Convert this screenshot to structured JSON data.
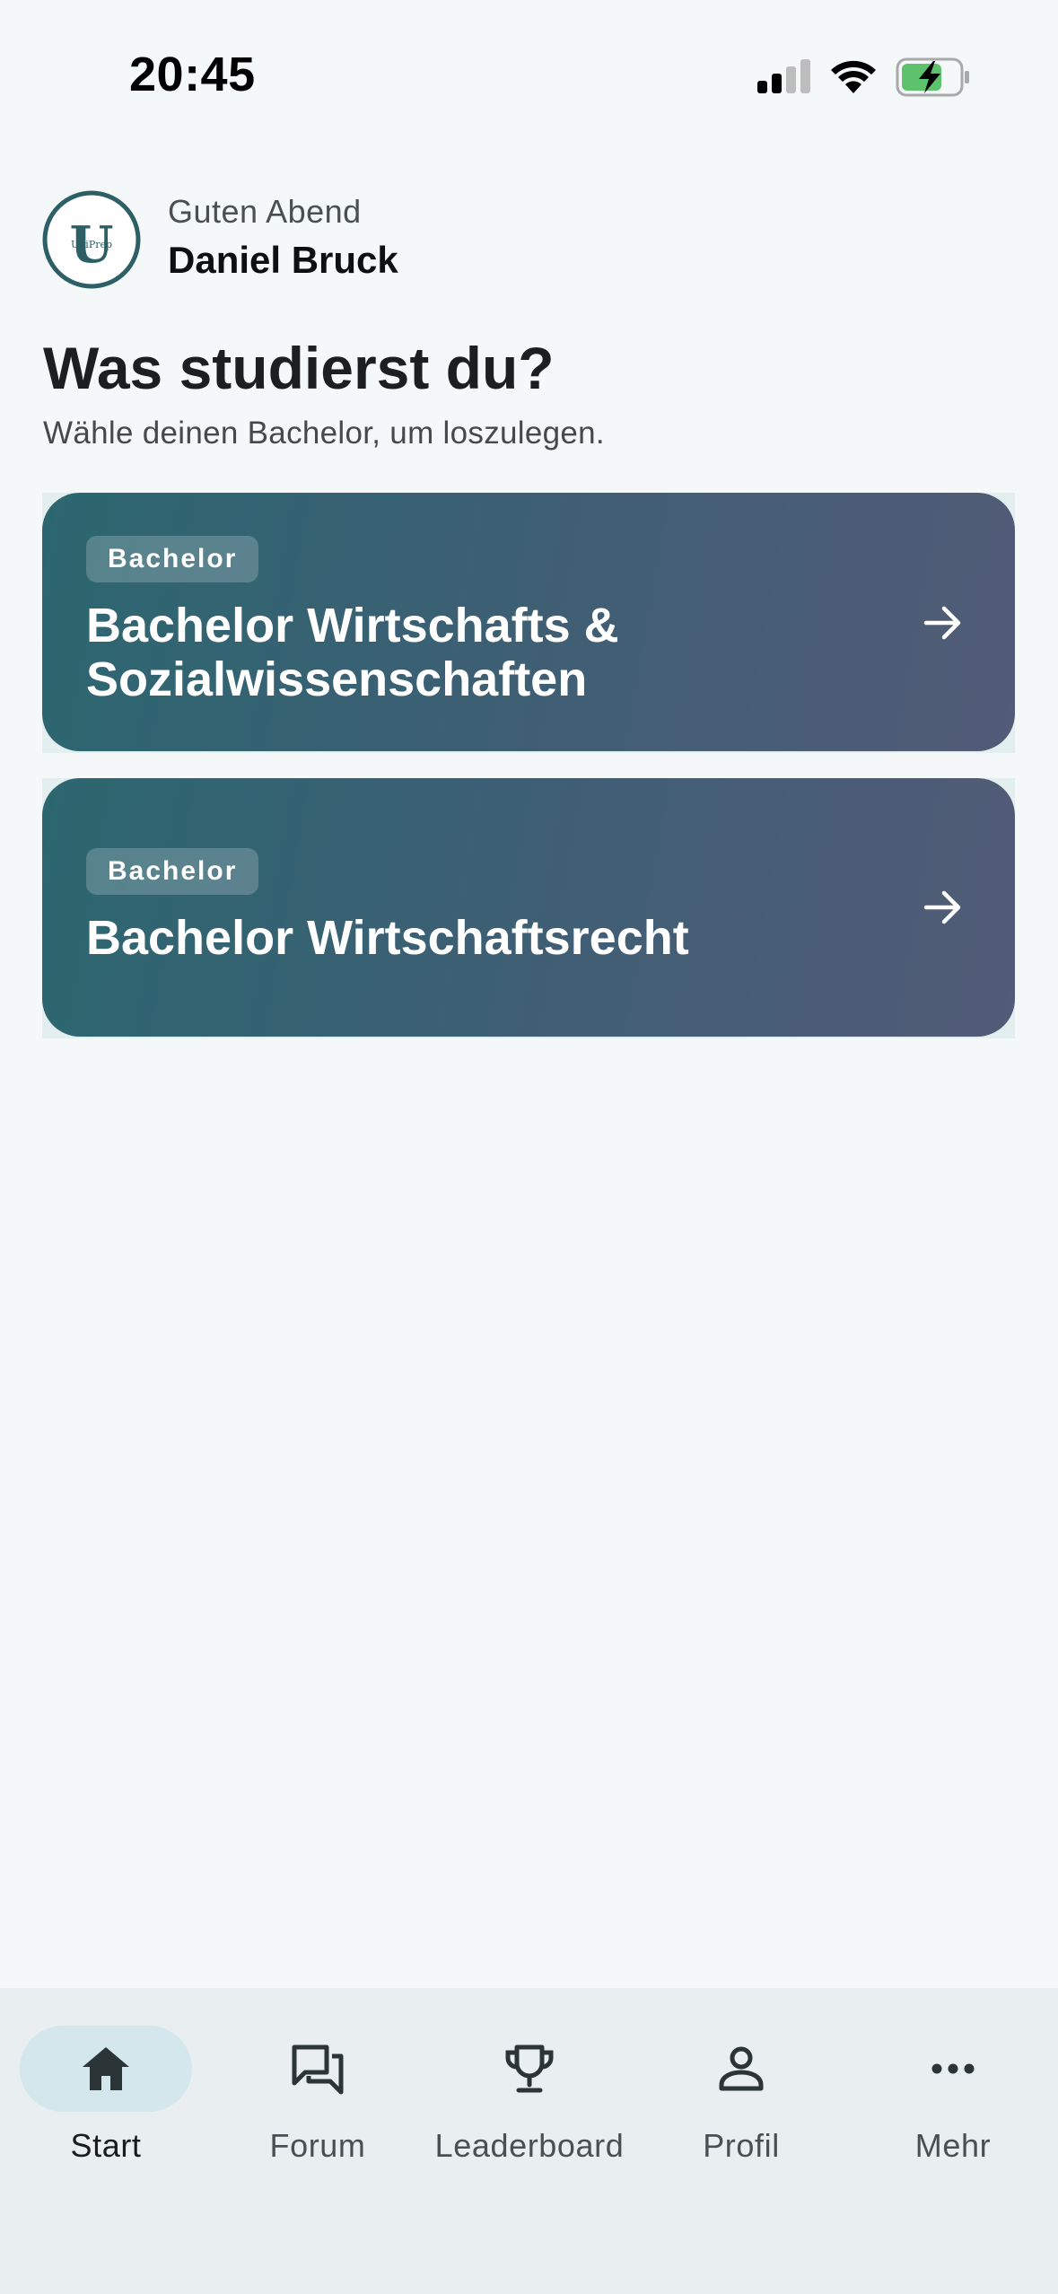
{
  "status_bar": {
    "time": "20:45"
  },
  "header": {
    "logo_text": "UniPrep",
    "greeting": "Guten Abend",
    "user_name": "Daniel Bruck"
  },
  "main": {
    "title": "Was studierst du?",
    "subtitle": "Wähle deinen Bachelor, um loszulegen.",
    "programs": [
      {
        "badge": "Bachelor",
        "title": "Bachelor Wirtschafts & Sozialwissenschaften"
      },
      {
        "badge": "Bachelor",
        "title": "Bachelor Wirtschaftsrecht"
      }
    ]
  },
  "bottom_nav": {
    "items": [
      {
        "label": "Start",
        "icon": "home-icon",
        "active": true
      },
      {
        "label": "Forum",
        "icon": "forum-icon",
        "active": false
      },
      {
        "label": "Leaderboard",
        "icon": "trophy-icon",
        "active": false
      },
      {
        "label": "Profil",
        "icon": "person-icon",
        "active": false
      },
      {
        "label": "Mehr",
        "icon": "more-icon",
        "active": false
      }
    ]
  },
  "colors": {
    "accent": "#2c6770",
    "card_gradient_end": "#525b77",
    "nav_active_pill": "#d3e7ec",
    "background": "#f4f8f9"
  }
}
